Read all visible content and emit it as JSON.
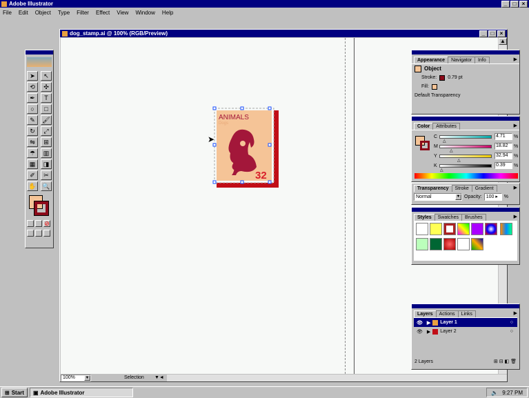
{
  "app": {
    "title": "Adobe Illustrator",
    "menu": [
      "File",
      "Edit",
      "Object",
      "Type",
      "Filter",
      "Effect",
      "View",
      "Window",
      "Help"
    ]
  },
  "doc": {
    "title": "dog_stamp.ai @ 100% (RGB/Preview)",
    "zoom": "100%",
    "status": "Selection"
  },
  "stamp": {
    "heading": "ANIMALS",
    "sub": "Dogs",
    "price": "32",
    "colors": {
      "bg": "#f5c497",
      "dog": "#a3173a",
      "shadow": "#c10e17",
      "price": "#d81e2a"
    }
  },
  "appearance": {
    "tabs": [
      "Appearance",
      "Navigator",
      "Info"
    ],
    "header": "Object",
    "stroke_label": "Stroke:",
    "stroke_value": "0.79 pt",
    "fill_label": "Fill:",
    "transparency": "Default Transparency"
  },
  "color": {
    "tabs": [
      "Color",
      "Attributes"
    ],
    "channels": [
      {
        "label": "C",
        "value": "4.71",
        "pct": 4.71
      },
      {
        "label": "M",
        "value": "18.82",
        "pct": 18.82
      },
      {
        "label": "Y",
        "value": "32.94",
        "pct": 32.94
      },
      {
        "label": "K",
        "value": "0.39",
        "pct": 0.39
      }
    ],
    "unit": "%"
  },
  "transparency": {
    "tabs": [
      "Transparency",
      "Stroke",
      "Gradient"
    ],
    "mode": "Normal",
    "opacity_label": "Opacity:",
    "opacity": "100",
    "unit": "%"
  },
  "styles": {
    "tabs": [
      "Styles",
      "Swatches",
      "Brushes"
    ]
  },
  "layers": {
    "tabs": [
      "Layers",
      "Actions",
      "Links"
    ],
    "items": [
      "Layer 1",
      "Layer 2"
    ],
    "count": "2 Layers"
  },
  "taskbar": {
    "start": "Start",
    "task": "Adobe Illustrator",
    "time": "9:27 PM"
  }
}
